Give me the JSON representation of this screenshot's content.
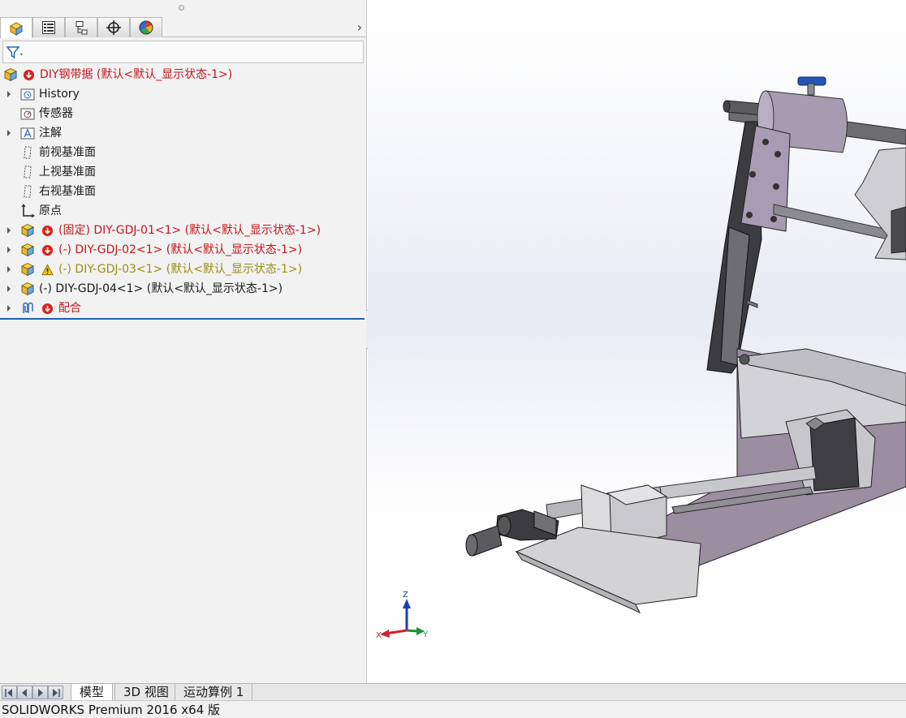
{
  "tabs": [
    {
      "name": "featuremanager-tab",
      "icon": "assembly-tree-icon",
      "active": true
    },
    {
      "name": "propertymanager-tab",
      "icon": "property-list-icon"
    },
    {
      "name": "configurationmanager-tab",
      "icon": "configuration-icon"
    },
    {
      "name": "dimxpert-tab",
      "icon": "crosshair-icon"
    },
    {
      "name": "displaymanager-tab",
      "icon": "appearance-pie-icon"
    }
  ],
  "tree": {
    "root_label": "DIY钢带据  (默认<默认_显示状态-1>)",
    "items": [
      {
        "label": "History",
        "icon": "history-folder-icon"
      },
      {
        "label": "传感器",
        "icon": "sensor-folder-icon"
      },
      {
        "label": "注解",
        "icon": "annotation-folder-icon"
      },
      {
        "label": "前视基准面",
        "icon": "plane-icon"
      },
      {
        "label": "上视基准面",
        "icon": "plane-icon"
      },
      {
        "label": "右视基准面",
        "icon": "plane-icon"
      },
      {
        "label": "原点",
        "icon": "origin-icon"
      },
      {
        "label": "(固定) DIY-GDJ-01<1> (默认<默认_显示状态-1>)",
        "icon": "part-icon",
        "status": "error"
      },
      {
        "label": "(-) DIY-GDJ-02<1> (默认<默认_显示状态-1>)",
        "icon": "part-icon",
        "status": "error"
      },
      {
        "label": "(-) DIY-GDJ-03<1> (默认<默认_显示状态-1>)",
        "icon": "part-icon",
        "status": "warning"
      },
      {
        "label": "(-) DIY-GDJ-04<1> (默认<默认_显示状态-1>)",
        "icon": "part-icon",
        "status": "none"
      },
      {
        "label": "配合",
        "icon": "mates-icon",
        "status": "error"
      }
    ]
  },
  "triad": {
    "x": "X",
    "y": "Y",
    "z": "Z"
  },
  "bottom_tabs": [
    "模型",
    "3D 视图",
    "运动算例 1"
  ],
  "status": {
    "text": "SOLIDWORKS Premium 2016 x64 版"
  },
  "colors": {
    "error_text": "#c4161c",
    "warning_text": "#9a8f12",
    "rollback_bar": "#1f5fb3",
    "part_purple": "#9a8ea0"
  }
}
